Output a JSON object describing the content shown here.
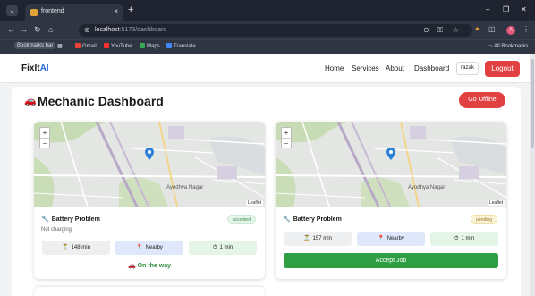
{
  "browser": {
    "tab_title": "frontend",
    "tab_close": "×",
    "new_tab": "+",
    "url_host": "localhost",
    "url_path": ":5173/dashboard",
    "window_controls": [
      "–",
      "❐",
      "✕"
    ],
    "profile_initial": "A",
    "bookmarks": [
      {
        "label": "Bookmarks bar"
      },
      {
        "label": "Gmail"
      },
      {
        "label": "YouTube"
      },
      {
        "label": "Maps"
      },
      {
        "label": "Translate"
      }
    ],
    "all_bookmarks": "All Bookmarks"
  },
  "navbar": {
    "logo_main": "FixIt",
    "logo_accent": "AI",
    "links": [
      "Home",
      "Services",
      "About",
      "Dashboard"
    ],
    "user": "razak",
    "logout": "Logout"
  },
  "dashboard": {
    "title": "Mechanic Dashboard",
    "offline_button": "Go Offline"
  },
  "map": {
    "zoom_in": "+",
    "zoom_out": "−",
    "place": "Ayodhya Nagar",
    "attribution": "Leaflet"
  },
  "jobs": [
    {
      "title": "Battery Problem",
      "description": "Not charging",
      "status": "accepted",
      "duration": "148 min",
      "proximity": "Nearby",
      "eta": "1 min",
      "action": "On the way"
    },
    {
      "title": "Battery Problem",
      "description": "",
      "status": "pending",
      "duration": "157 min",
      "proximity": "Nearby",
      "eta": "1 min",
      "action": "Accept Job"
    }
  ],
  "colors": {
    "accent_red": "#e24141",
    "accept_green": "#2e9e44",
    "link_blue": "#2a6bd9"
  }
}
